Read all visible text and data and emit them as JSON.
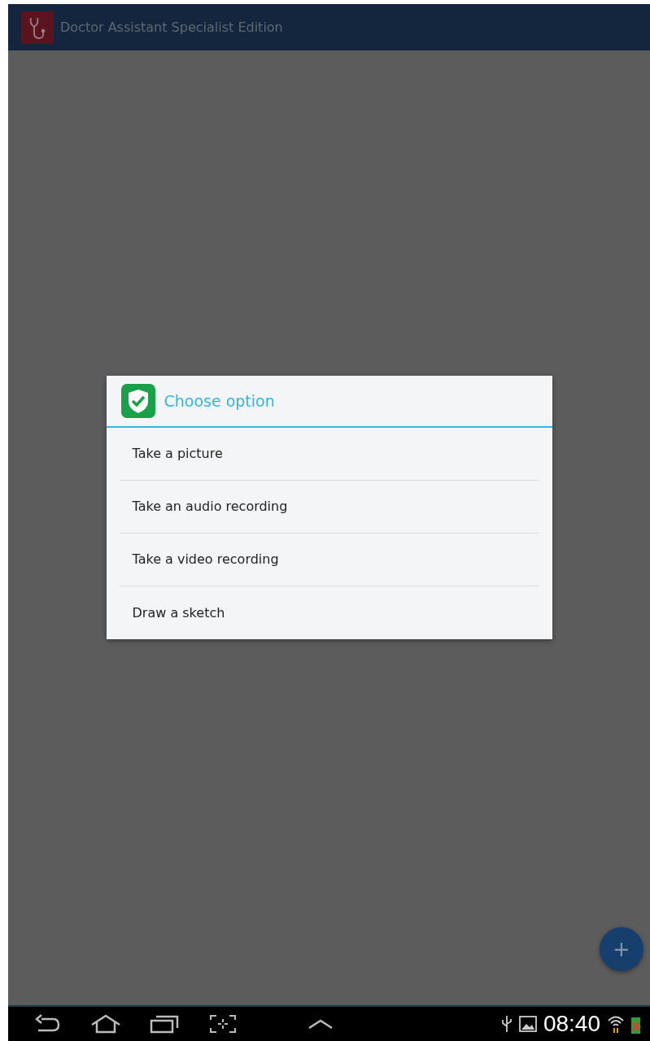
{
  "app_bar": {
    "title": "Doctor Assistant Specialist Edition"
  },
  "dialog": {
    "title": "Choose option",
    "options": [
      {
        "label": "Take a picture"
      },
      {
        "label": "Take an audio recording"
      },
      {
        "label": "Take a video recording"
      },
      {
        "label": "Draw a sketch"
      }
    ]
  },
  "fab": {
    "label": "+"
  },
  "status_bar": {
    "time": "08:40"
  }
}
